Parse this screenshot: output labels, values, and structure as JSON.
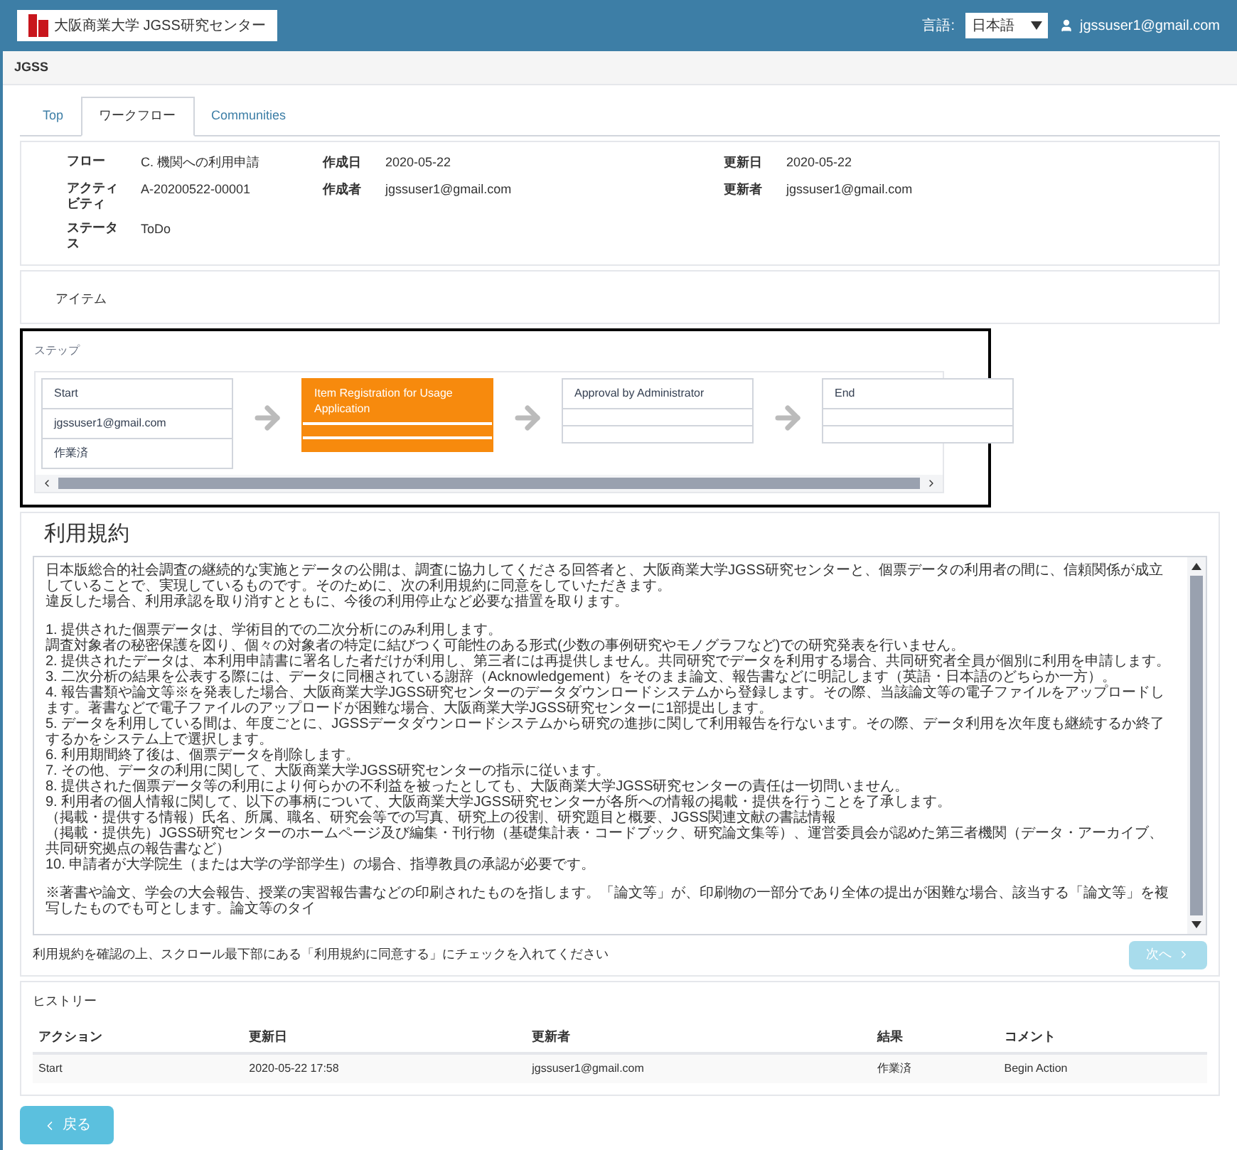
{
  "header": {
    "logo_lines": [
      "大阪商業大学 JGSS研究センター"
    ],
    "language_label": "言語:",
    "language": "日本語",
    "user": "jgssuser1@gmail.com"
  },
  "breadcrumb": "JGSS",
  "tabs": [
    {
      "label": "Top",
      "selected": false
    },
    {
      "label": "ワークフロー",
      "selected": true
    },
    {
      "label": "Communities",
      "selected": false
    }
  ],
  "info": [
    {
      "label": "フロー",
      "value": "C. 機関への利用申請",
      "label2": "作成日",
      "value2": "2020-05-22",
      "label3": "更新日",
      "value3": "2020-05-22"
    },
    {
      "label": "アクティビティ",
      "value": "A-20200522-00001",
      "label2": "作成者",
      "value2": "jgssuser1@gmail.com",
      "label3": "更新者",
      "value3": "jgssuser1@gmail.com"
    },
    {
      "label": "ステータス",
      "value": "ToDo"
    }
  ],
  "item_section": "アイテム",
  "steps_title": "ステップ",
  "steps": [
    {
      "title": "Start",
      "user": "jgssuser1@gmail.com",
      "status": "作業済",
      "selected": false
    },
    {
      "title": "Item Registration for Usage Application",
      "selected": true
    },
    {
      "title": "Approval by Administrator",
      "selected": false
    },
    {
      "title": "End",
      "selected": false
    }
  ],
  "terms": {
    "title": "利用規約",
    "paragraph_groups": [
      [
        "日本版総合的社会調査の継続的な実施とデータの公開は、調査に協力してくださる回答者と、大阪商業大学JGSS研究センターと、個票データの利用者の間に、信頼関係が成立していることで、実現しているものです。そのために、次の利用規約に同意をしていただきます。",
        "違反した場合、利用承認を取り消すとともに、今後の利用停止など必要な措置を取ります。"
      ],
      [
        "1. 提供された個票データは、学術目的での二次分析にのみ利用します。",
        "調査対象者の秘密保護を図り、個々の対象者の特定に結びつく可能性のある形式(少数の事例研究やモノグラフなど)での研究発表を行いません。",
        "2. 提供されたデータは、本利用申請書に署名した者だけが利用し、第三者には再提供しません。共同研究でデータを利用する場合、共同研究者全員が個別に利用を申請します。",
        "3. 二次分析の結果を公表する際には、データに同梱されている謝辞（Acknowledgement）をそのまま論文、報告書などに明記します（英語・日本語のどちらか一方）。",
        "4. 報告書類や論文等※を発表した場合、大阪商業大学JGSS研究センターのデータダウンロードシステムから登録します。その際、当該論文等の電子ファイルをアップロードします。著書などで電子ファイルのアップロードが困難な場合、大阪商業大学JGSS研究センターに1部提出します。",
        "5. データを利用している間は、年度ごとに、JGSSデータダウンロードシステムから研究の進捗に関して利用報告を行ないます。その際、データ利用を次年度も継続するか終了するかをシステム上で選択します。",
        "6. 利用期間終了後は、個票データを削除します。",
        "7. その他、データの利用に関して、大阪商業大学JGSS研究センターの指示に従います。",
        "8. 提供された個票データ等の利用により何らかの不利益を被ったとしても、大阪商業大学JGSS研究センターの責任は一切問いません。",
        "9. 利用者の個人情報に関して、以下の事柄について、大阪商業大学JGSS研究センターが各所への情報の掲載・提供を行うことを了承します。",
        "（掲載・提供する情報）氏名、所属、職名、研究会等での写真、研究上の役割、研究題目と概要、JGSS関連文献の書誌情報",
        "（掲載・提供先）JGSS研究センターのホームページ及び編集・刊行物（基礎集計表・コードブック、研究論文集等）、運営委員会が認めた第三者機関（データ・アーカイブ、共同研究拠点の報告書など）",
        "10. 申請者が大学院生（または大学の学部学生）の場合、指導教員の承認が必要です。"
      ],
      [
        "※著書や論文、学会の大会報告、授業の実習報告書などの印刷されたものを指します。「論文等」が、印刷物の一部分であり全体の提出が困難な場合、該当する「論文等」を複写したものでも可とします。論文等のタイ"
      ]
    ],
    "instruction": "利用規約を確認の上、スクロール最下部にある「利用規約に同意する」にチェックを入れてください",
    "next_button": "次へ",
    "next_disabled": true
  },
  "history": {
    "title": "ヒストリー",
    "columns": [
      "アクション",
      "更新日",
      "更新者",
      "結果",
      "コメント"
    ],
    "rows": [
      [
        "Start",
        "2020-05-22 17:58",
        "jgssuser1@gmail.com",
        "作業済",
        "Begin Action"
      ]
    ]
  },
  "back_button": "戻る"
}
